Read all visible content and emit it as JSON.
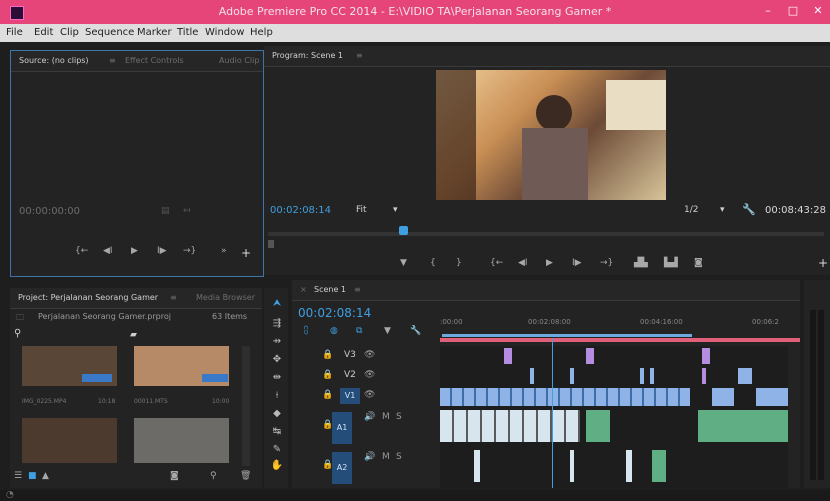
{
  "window": {
    "title": "Adobe Premiere Pro CC 2014 - E:\\VIDIO TA\\Perjalanan Seorang Gamer *"
  },
  "menu": [
    "File",
    "Edit",
    "Clip",
    "Sequence",
    "Marker",
    "Title",
    "Window",
    "Help"
  ],
  "source_panel": {
    "tabs": [
      "Source: (no clips)",
      "Effect Controls",
      "Audio Clip"
    ],
    "timecode": "00:00:00:00"
  },
  "program_panel": {
    "tab": "Program: Scene 1",
    "timecode": "00:02:08:14",
    "fit": "Fit",
    "resolution": "1/2",
    "duration": "00:08:43:28"
  },
  "project_panel": {
    "tabs": [
      "Project: Perjalanan Seorang Gamer",
      "Media Browser"
    ],
    "project_file": "Perjalanan Seorang Gamer.prproj",
    "item_count": "63 Items",
    "thumbs": [
      {
        "name": "IMG_0225.MP4",
        "duration": "10:18"
      },
      {
        "name": "00011.MTS",
        "duration": "10:00"
      }
    ]
  },
  "timeline": {
    "tab": "Scene 1",
    "timecode": "00:02:08:14",
    "ruler": [
      ":00:00",
      "00:02:08:00",
      "00:04:16:00",
      "00:06:2"
    ],
    "tracks": [
      {
        "id": "V3",
        "kind": "video"
      },
      {
        "id": "V2",
        "kind": "video"
      },
      {
        "id": "V1",
        "kind": "video"
      },
      {
        "id": "A1",
        "kind": "audio"
      },
      {
        "id": "A2",
        "kind": "audio"
      }
    ],
    "audio_track_labels": {
      "mute": "M",
      "solo": "S"
    }
  },
  "colors": {
    "accent": "#3f9fe0",
    "title_bar": "#e6457a",
    "video_clip": "#8fb3e6",
    "audio_clip": "#5fae84",
    "marker_clip": "#b48de0"
  }
}
